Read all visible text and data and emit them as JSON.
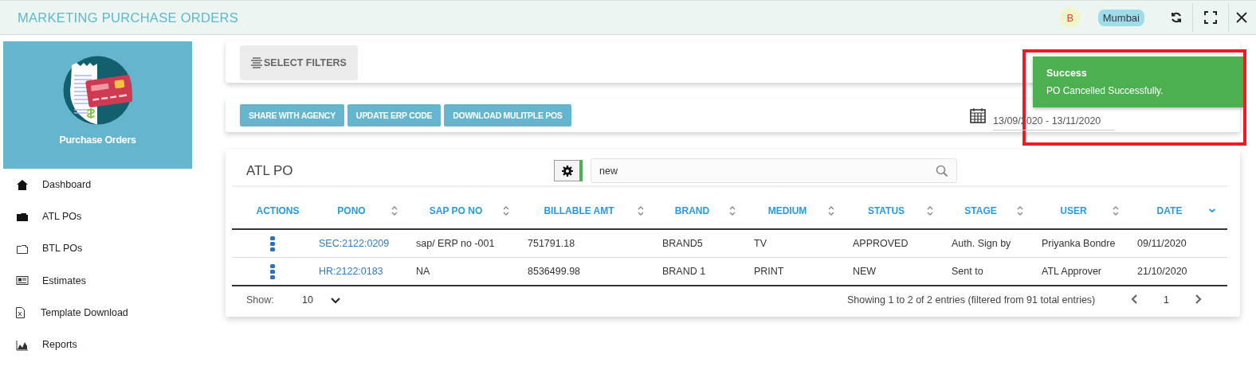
{
  "header": {
    "title": "MARKETING PURCHASE ORDERS",
    "avatar": "B",
    "location": "Mumbai"
  },
  "sidebar": {
    "title": "Purchase Orders",
    "items": [
      {
        "label": "Dashboard",
        "selected": false
      },
      {
        "label": "ATL POs",
        "selected": false
      },
      {
        "label": "BTL POs",
        "selected": false
      },
      {
        "label": "Estimates",
        "selected": false
      },
      {
        "label": "Template Download",
        "selected": false
      },
      {
        "label": "Reports",
        "selected": false
      }
    ]
  },
  "filters": {
    "button": "SELECT FILTERS"
  },
  "actions": [
    "SHARE WITH AGENCY",
    "UPDATE ERP CODE",
    "DOWNLOAD MULITPLE POS"
  ],
  "date_range": "13/09/2020 - 13/11/2020",
  "table": {
    "title": "ATL PO",
    "search": {
      "value": "new"
    },
    "columns": [
      {
        "label": "ACTIONS",
        "sortable": false,
        "sorted": false
      },
      {
        "label": "PONO",
        "sortable": true,
        "sorted": false
      },
      {
        "label": "SAP PO NO",
        "sortable": true,
        "sorted": false
      },
      {
        "label": "BILLABLE AMT",
        "sortable": true,
        "sorted": false
      },
      {
        "label": "BRAND",
        "sortable": true,
        "sorted": false
      },
      {
        "label": "MEDIUM",
        "sortable": true,
        "sorted": false
      },
      {
        "label": "STATUS",
        "sortable": true,
        "sorted": false
      },
      {
        "label": "STAGE",
        "sortable": true,
        "sorted": false
      },
      {
        "label": "USER",
        "sortable": true,
        "sorted": false
      },
      {
        "label": "DATE",
        "sortable": true,
        "sorted": true
      }
    ],
    "rows": [
      [
        "",
        "SEC:2122:0209",
        "sap/ ERP no -001",
        "751791.18",
        "BRAND5",
        "TV",
        "APPROVED",
        "Auth. Sign by",
        "Priyanka Bondre",
        "09/11/2020"
      ],
      [
        "",
        "HR:2122:0183",
        "NA",
        "8536499.98",
        "BRAND 1",
        "PRINT",
        "NEW",
        "Sent to",
        "ATL Approver",
        "21/10/2020"
      ]
    ],
    "show_label": "Show:",
    "page_size": "10",
    "info": "Showing 1 to 2 of 2 entries (filtered from 91 total entries)",
    "page": "1"
  },
  "toast": {
    "title": "Success",
    "message": "PO Cancelled Successfully.",
    "highlighted": true
  }
}
